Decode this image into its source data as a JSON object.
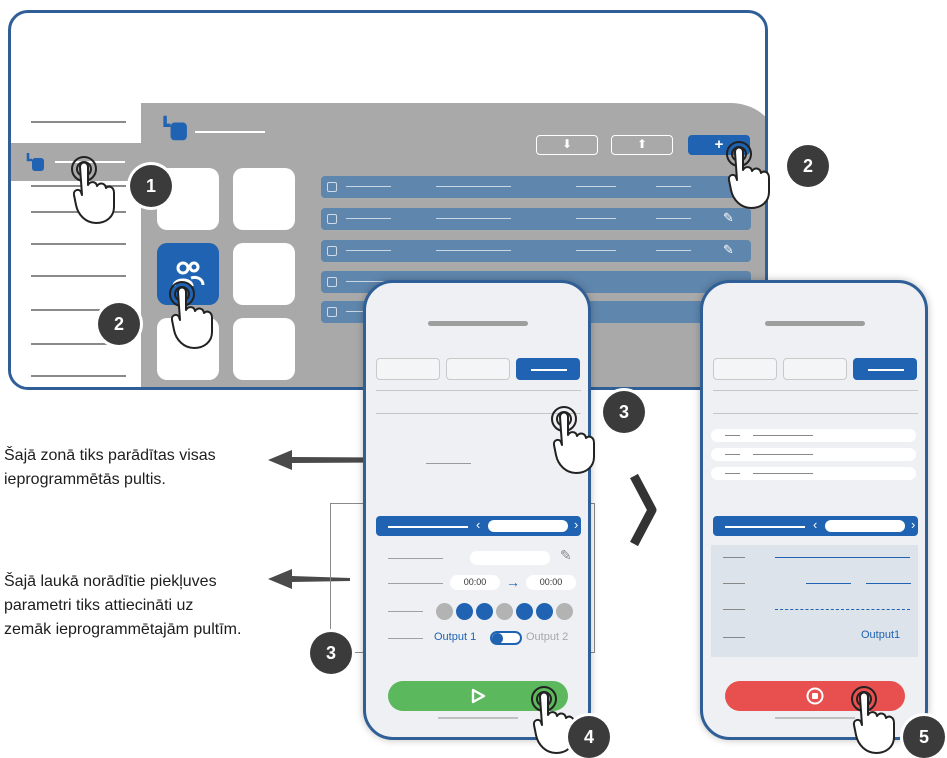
{
  "captions": {
    "zone_text": "Šajā zonā tiks parādītas visas ieprogrammētās pultis.",
    "field_text": "Šajā laukā norādītie piekļuves parametri tiks attiecināti uz zemāk ieprogrammētajām pultīm."
  },
  "step_badges": [
    "1",
    "2",
    "2",
    "3",
    "3",
    "4",
    "5"
  ],
  "phone1": {
    "time_from": "00:00",
    "time_to": "00:00",
    "output1_label": "Output 1",
    "output2_label": "Output 2",
    "days_on": [
      false,
      true,
      true,
      false,
      true,
      true,
      false
    ]
  },
  "phone2": {
    "output_label": "Output1"
  },
  "icons": {
    "download": "download-icon",
    "upload": "upload-icon",
    "add": "plus-icon",
    "edit": "pencil-icon",
    "play": "play-icon",
    "stop": "stop-icon",
    "users": "users-group-icon",
    "remote": "remote-icon",
    "chevron": "chevron-right-icon"
  },
  "colors": {
    "frame": "#2f5f96",
    "accent_blue": "#1f63b2",
    "row_blue": "#5f86ad",
    "start_green": "#5cb85c",
    "stop_red": "#e85050",
    "panel_grey": "#a9a9a9"
  }
}
